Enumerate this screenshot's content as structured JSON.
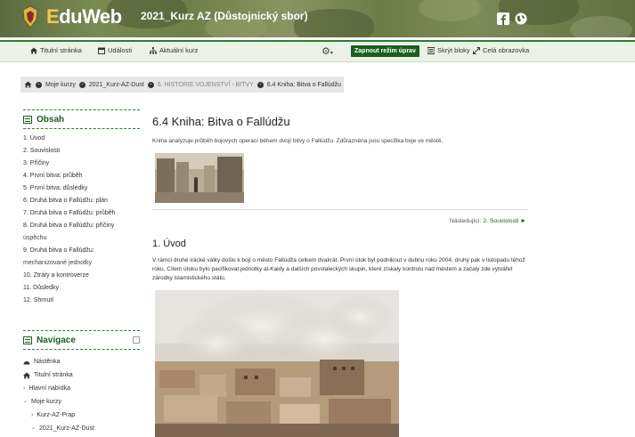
{
  "header": {
    "logo_prefix": "E",
    "logo_rest": "duWeb",
    "course_title": "2021_Kurz AZ (Důstojnický sbor)",
    "icons": [
      "facebook-icon",
      "globe-icon"
    ]
  },
  "navbar": {
    "home": "Titulní stránka",
    "events": "Události",
    "current_course": "Aktuální kurz",
    "edit_mode": "Zapnout režim úprav",
    "hide_blocks": "Skrýt bloky",
    "fullscreen": "Celá obrazovka"
  },
  "breadcrumb": {
    "items": [
      "Moje kurzy",
      "2021_Kurz-AZ-Dust",
      "6. HISTORIE VOJENSTVÍ - BITVY",
      "6.4 Kniha: Bitva o Fallúdžu"
    ]
  },
  "toc": {
    "title": "Obsah",
    "items": [
      "1. Úvod",
      "2. Souvislosti",
      "3. Příčiny",
      "4. První bitva: průběh",
      "5. První bitva: důsledky",
      "6. Druhá bitva o Fallúdžu: plán",
      "7. Druhá bitva o Fallúdžu: průběh",
      "8. Druhá bitva o Fallúdžu: příčiny",
      "úspěchu",
      "9. Druhá bitva o Fallúdžu:",
      "mechanizované jednotky",
      "10. Ztráty a kontroverze",
      "11. Důsledky",
      "12. Shrnutí"
    ]
  },
  "navigation": {
    "title": "Navigace",
    "items": [
      "Nástěnka",
      "Titulní stránka",
      "Hlavní nabídka",
      "Moje kurzy",
      "Kurz-AZ-Prap",
      "2021_Kurz-AZ-Dust"
    ]
  },
  "main": {
    "title": "6.4 Kniha: Bitva o Fallúdžu",
    "intro": "Kniha analyzuje průběh bojových operací během dvojí bitvy o Fallúdžu. Zdůrazněna jsou specifika boje ve městě.",
    "next_label": "Následující: ",
    "next_link": "2. Souvislosti ►",
    "section_title": "1. Úvod",
    "section_text": "V rámci druhé irácké války došlo k boji o město Fallúdža celkem dvakrát. První útok byl podniknut v dubnu roku 2004; druhý pak v listopadu téhož roku. Cílem útoku bylo pacifikovat jednotky al-Kaidy a dalších povstaleckých skupin, které získaly kontrolu nad městem a začaly zde vytvářet zárodky islamistického státu."
  },
  "colors": {
    "accent": "#1b5e20",
    "navbar_bg": "#e9f2e4",
    "breadcrumb_bg": "#e6e6e6"
  }
}
